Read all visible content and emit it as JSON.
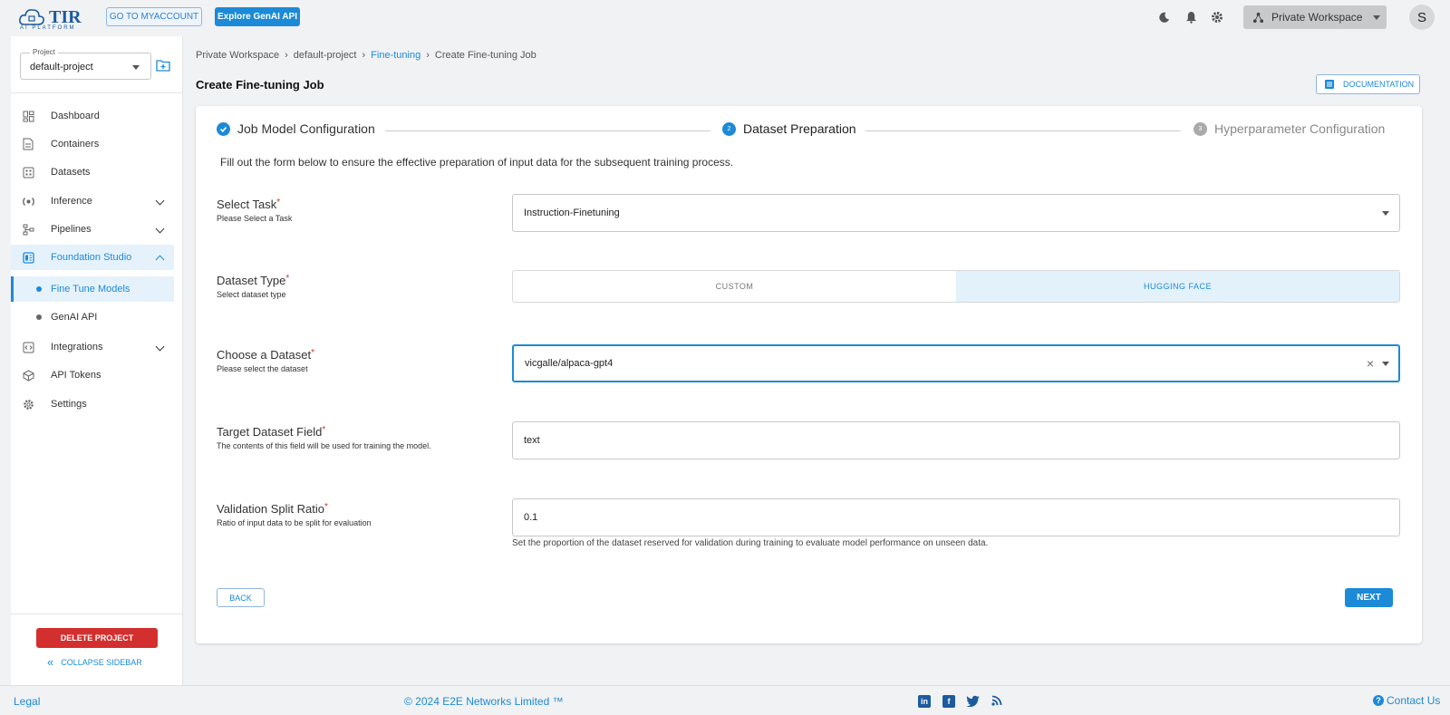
{
  "topbar": {
    "logo_text": "TIR",
    "logo_sub": "AI PLATFORM",
    "myaccount_label": "GO TO MYACCOUNT",
    "genai_label": "Explore GenAI API",
    "workspace_label": "Private Workspace",
    "avatar_letter": "S"
  },
  "sidebar": {
    "project_label": "Project",
    "project_value": "default-project",
    "items": [
      {
        "label": "Dashboard",
        "icon": "dashboard-icon"
      },
      {
        "label": "Containers",
        "icon": "document-icon"
      },
      {
        "label": "Datasets",
        "icon": "grid-icon"
      },
      {
        "label": "Inference",
        "icon": "inference-icon"
      },
      {
        "label": "Pipelines",
        "icon": "pipeline-icon"
      },
      {
        "label": "Foundation Studio",
        "icon": "studio-icon"
      },
      {
        "label": "Integrations",
        "icon": "code-icon"
      },
      {
        "label": "API Tokens",
        "icon": "token-icon"
      },
      {
        "label": "Settings",
        "icon": "gear-icon"
      }
    ],
    "sub_items": [
      {
        "label": "Fine Tune Models"
      },
      {
        "label": "GenAI API"
      }
    ],
    "delete_label": "DELETE PROJECT",
    "collapse_label": "COLLAPSE SIDEBAR"
  },
  "breadcrumb": [
    "Private Workspace",
    "default-project",
    "Fine-tuning",
    "Create Fine-tuning Job"
  ],
  "page_title": "Create Fine-tuning Job",
  "doc_label": "DOCUMENTATION",
  "stepper": [
    {
      "label": "Job Model Configuration",
      "state": "done"
    },
    {
      "label": "Dataset Preparation",
      "state": "active",
      "num": "2"
    },
    {
      "label": "Hyperparameter Configuration",
      "state": "pending",
      "num": "3"
    }
  ],
  "intro": "Fill out the form below to ensure the effective preparation of input data for the subsequent training process.",
  "form": {
    "task": {
      "label": "Select Task",
      "help": "Please Select a Task",
      "value": "Instruction-Finetuning"
    },
    "dataset_type": {
      "label": "Dataset Type",
      "help": "Select dataset type",
      "options": [
        "CUSTOM",
        "HUGGING FACE"
      ],
      "selected": "HUGGING FACE"
    },
    "dataset": {
      "label": "Choose a Dataset",
      "help": "Please select the dataset",
      "value": "vicgalle/alpaca-gpt4"
    },
    "target_field": {
      "label": "Target Dataset Field",
      "help": "The contents of this field will be used for training the model.",
      "value": "text"
    },
    "split": {
      "label": "Validation Split Ratio",
      "help": "Ratio of input data to be split for evaluation",
      "value": "0.1",
      "hint": "Set the proportion of the dataset reserved for validation during training to evaluate model performance on unseen data."
    },
    "required_mark": "*"
  },
  "buttons": {
    "back": "BACK",
    "next": "NEXT"
  },
  "footer": {
    "legal": "Legal",
    "copyright": "© 2024 E2E Networks Limited ™",
    "contact": "Contact Us",
    "social": [
      "linkedin-icon",
      "facebook-icon",
      "twitter-icon",
      "rss-icon"
    ]
  },
  "colors": {
    "accent": "#1c8ad6",
    "danger": "#d32f2f",
    "brand": "#1c5b9e"
  }
}
